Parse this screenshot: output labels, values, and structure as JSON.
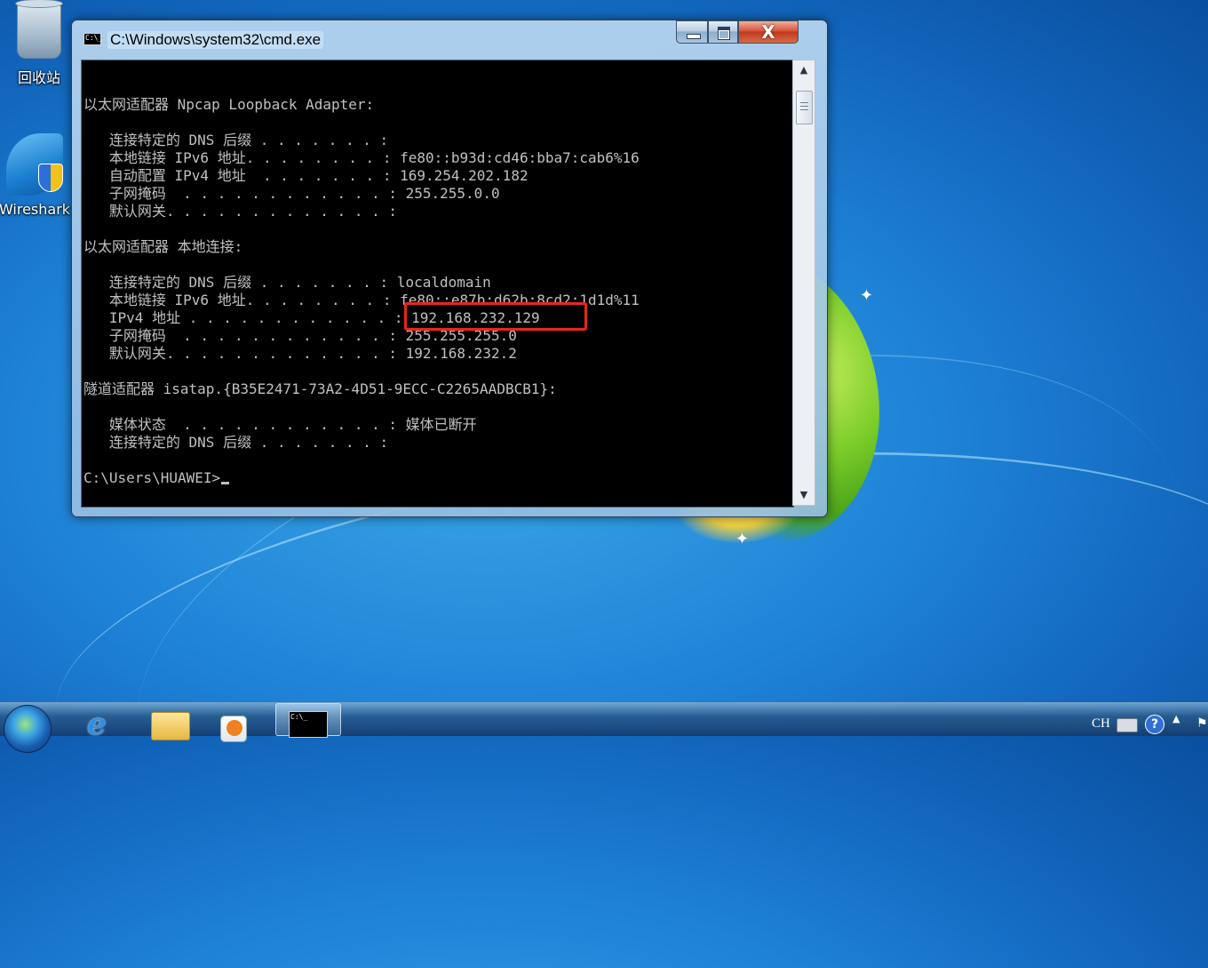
{
  "desktop": {
    "icons": [
      {
        "label": "回收站"
      },
      {
        "label": "Wireshark"
      }
    ]
  },
  "window": {
    "title": "C:\\Windows\\system32\\cmd.exe",
    "min_glyph": "",
    "max_glyph": "",
    "close_glyph": "X",
    "title_icon_text": "C:\\_"
  },
  "console": {
    "lines": [
      "以太网适配器 Npcap Loopback Adapter:",
      "",
      "   连接特定的 DNS 后缀 . . . . . . . :",
      "   本地链接 IPv6 地址. . . . . . . . : fe80::b93d:cd46:bba7:cab6%16",
      "   自动配置 IPv4 地址  . . . . . . . : 169.254.202.182",
      "   子网掩码  . . . . . . . . . . . . : 255.255.0.0",
      "   默认网关. . . . . . . . . . . . . :",
      "",
      "以太网适配器 本地连接:",
      "",
      "   连接特定的 DNS 后缀 . . . . . . . : localdomain",
      "   本地链接 IPv6 地址. . . . . . . . : fe80::e87b:d62b:8cd2:1d1d%11",
      "   IPv4 地址 . . . . . . . . . . . . : 192.168.232.129",
      "   子网掩码  . . . . . . . . . . . . : 255.255.255.0",
      "   默认网关. . . . . . . . . . . . . : 192.168.232.2",
      "",
      "隧道适配器 isatap.{B35E2471-73A2-4D51-9ECC-C2265AADBCB1}:",
      "",
      "   媒体状态  . . . . . . . . . . . . : 媒体已断开",
      "   连接特定的 DNS 后缀 . . . . . . . :",
      "",
      "C:\\Users\\HUAWEI>"
    ],
    "highlight_color": "#e8261c"
  },
  "taskbar": {
    "cmd_icon_text": "C:\\_",
    "tray": {
      "language": "CH",
      "help_glyph": "?",
      "more_glyph": "▲",
      "flag_glyph": "⚑"
    }
  },
  "icons": {
    "recycle": "recycle-bin-icon",
    "wireshark": "wireshark-icon",
    "start": "windows-start-icon",
    "ie": "internet-explorer-icon",
    "folder": "folder-icon",
    "media": "media-player-icon",
    "cmd": "cmd-icon"
  }
}
